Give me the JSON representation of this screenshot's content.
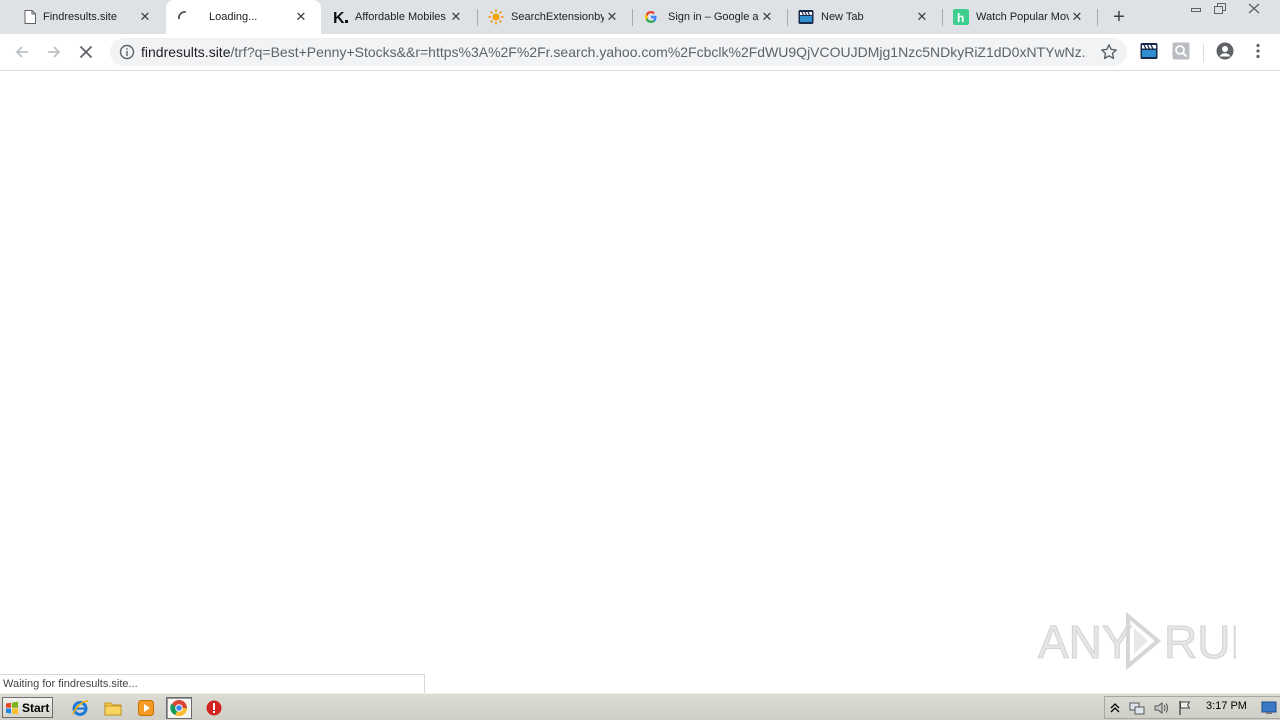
{
  "browser": {
    "tabs": [
      {
        "title": "Findresults.site",
        "favicon": "page-icon",
        "active": false
      },
      {
        "title": "Loading...",
        "favicon": "loading-spinner-icon",
        "active": true
      },
      {
        "title": "Affordable Mobiles",
        "favicon": "k-logo-icon",
        "active": false
      },
      {
        "title": "SearchExtensionby",
        "favicon": "sun-icon",
        "active": false
      },
      {
        "title": "Sign in – Google ac",
        "favicon": "google-g-icon",
        "active": false
      },
      {
        "title": "New Tab",
        "favicon": "clapperboard-icon",
        "active": false
      },
      {
        "title": "Watch Popular Mov",
        "favicon": "h-logo-icon",
        "active": false
      }
    ],
    "new_tab_label": "+",
    "address": {
      "host": "findresults.site",
      "path": "/trf?q=Best+Penny+Stocks&&r=https%3A%2F%2Fr.search.yahoo.com%2Fcbclk%2FdWU9QjVCOUJDMjg1Nzc5NDkyRiZ1dD0xNTYwNz..."
    },
    "status_text": "Waiting for findresults.site..."
  },
  "watermark": {
    "text_left": "ANY",
    "text_right": "RUN"
  },
  "taskbar": {
    "start_label": "Start",
    "clock": "3:17 PM"
  },
  "colors": {
    "tabstrip_bg": "#dee1e6",
    "omnibox_bg": "#f1f3f4",
    "taskbar_bg": "#d4d0c8"
  }
}
